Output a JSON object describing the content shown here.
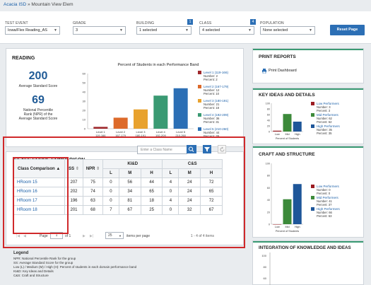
{
  "breadcrumb": {
    "root": "Acacia ISD",
    "sep": " » ",
    "current": "Mountain View Elem"
  },
  "filters": {
    "test_event": {
      "label": "TEST EVENT",
      "value": "Iowa/Flex Reading_AS"
    },
    "grade": {
      "label": "GRADE",
      "value": "3"
    },
    "building": {
      "label": "BUILDING",
      "value": "1 selected",
      "badge": "1"
    },
    "class": {
      "label": "CLASS",
      "value": "4 selected",
      "badge": "4"
    },
    "population": {
      "label": "POPULATION",
      "value": "None selected"
    },
    "reset": "Reset Page"
  },
  "reading": {
    "title": "READING",
    "avg_score": "200",
    "avg_label": "Average Standard Score",
    "npr": "69",
    "npr_label_1": "National Percentile",
    "npr_label_2": "Rank (NPR) of the",
    "npr_label_3": "Average Standard Score"
  },
  "chart_data": [
    {
      "type": "bar",
      "title": "Percent of Students in each Performance Band",
      "categories": [
        "Level 1 119-166",
        "Level 2 167-179",
        "Level 3 180-191",
        "Level 4 192-209",
        "Level 5 210-260"
      ],
      "values": [
        2,
        12,
        21,
        36,
        44
      ],
      "ylim": [
        0,
        60
      ],
      "colors": [
        "#a0282c",
        "#dd6a2a",
        "#e8a22e",
        "#3a9a73",
        "#2c6fb5"
      ],
      "series_labels": [
        {
          "name": "Level 1 (119-166)",
          "number": "Number: 2",
          "percent": "Percent: 2"
        },
        {
          "name": "Level 2 (167-179)",
          "number": "Number: 12",
          "percent": "Percent: 10"
        },
        {
          "name": "Level 3 (180-191)",
          "number": "Number: 21",
          "percent": "Percent: 18"
        },
        {
          "name": "Level 4 (192-209)",
          "number": "Number: 36",
          "percent": "Percent: 31"
        },
        {
          "name": "Level 5 (210-260)",
          "number": "Number: 44",
          "percent": "Percent: 39"
        }
      ]
    },
    {
      "type": "bar",
      "title": "KEY IDEAS AND DETAILS",
      "categories": [
        "Low",
        "Mid",
        "High"
      ],
      "values": [
        3,
        62,
        35
      ],
      "ylim": [
        0,
        100
      ],
      "xlabel": "Percent of Students",
      "colors": [
        "#9b1c22",
        "#3c8a3a",
        "#1e5699"
      ],
      "legend": [
        {
          "name": "Low Performers",
          "number": "Number: 3",
          "percent": "Percent: 3"
        },
        {
          "name": "Mid Performers",
          "number": "Number: 62",
          "percent": "Percent: 62"
        },
        {
          "name": "High Performers",
          "number": "Number: 35",
          "percent": "Percent: 35"
        }
      ]
    },
    {
      "type": "bar",
      "title": "CRAFT AND STRUCTURE",
      "categories": [
        "Low",
        "Mid",
        "High"
      ],
      "values": [
        0,
        41,
        66
      ],
      "ylim": [
        0,
        100
      ],
      "xlabel": "Percent of Students",
      "colors": [
        "#9b1c22",
        "#3c8a3a",
        "#1e5699"
      ],
      "legend": [
        {
          "name": "Low Performers",
          "number": "Number: 0",
          "percent": "Percent: 0"
        },
        {
          "name": "Mid Performers",
          "number": "Number: 41",
          "percent": "Percent: 37"
        },
        {
          "name": "High Performers",
          "number": "Number: 66",
          "percent": "Percent: 63"
        }
      ]
    }
  ],
  "print": {
    "title": "PRINT REPORTS",
    "item": "Print Dashboard"
  },
  "integration": {
    "title": "INTEGRATION OF KNOWLEDGE AND IDEAS"
  },
  "class_compare": {
    "title": "CLASS SCORE COMPARISON",
    "search_placeholder": "Enter a Class Name",
    "headers": {
      "name": "Class Comparison",
      "ss": "SS",
      "npr": "NPR",
      "kid": "KI&D",
      "cs": "C&S",
      "l": "L",
      "m": "M",
      "h": "H"
    },
    "rows": [
      {
        "name": "HRoom 15",
        "ss": "207",
        "npr": "75",
        "kl": "0",
        "km": "56",
        "kh": "44",
        "cl": "4",
        "cm": "24",
        "ch": "72"
      },
      {
        "name": "HRoom 16",
        "ss": "202",
        "npr": "74",
        "kl": "0",
        "km": "34",
        "kh": "65",
        "cl": "0",
        "cm": "24",
        "ch": "65"
      },
      {
        "name": "HRoom 17",
        "ss": "196",
        "npr": "63",
        "kl": "0",
        "km": "81",
        "kh": "18",
        "cl": "4",
        "cm": "24",
        "ch": "72"
      },
      {
        "name": "HRoom 18",
        "ss": "201",
        "npr": "68",
        "kl": "7",
        "km": "67",
        "kh": "25",
        "cl": "0",
        "cm": "32",
        "ch": "67"
      }
    ],
    "pager": {
      "page_label": "Page",
      "page": "1",
      "of": "of 1",
      "per_page": "25",
      "per_page_label": "items per page",
      "count": "1 - 4 of 4 items"
    }
  },
  "legend": {
    "title": "Legend",
    "lines": [
      "NPR: National Percentile Rank for the group",
      "SS: Average Standard Score for the group",
      "Low (L) / Medium (M) / High (H): Percent of students in each domain performance band",
      "KI&D: Key Ideas and Details",
      "C&S: Craft and Structure"
    ]
  }
}
